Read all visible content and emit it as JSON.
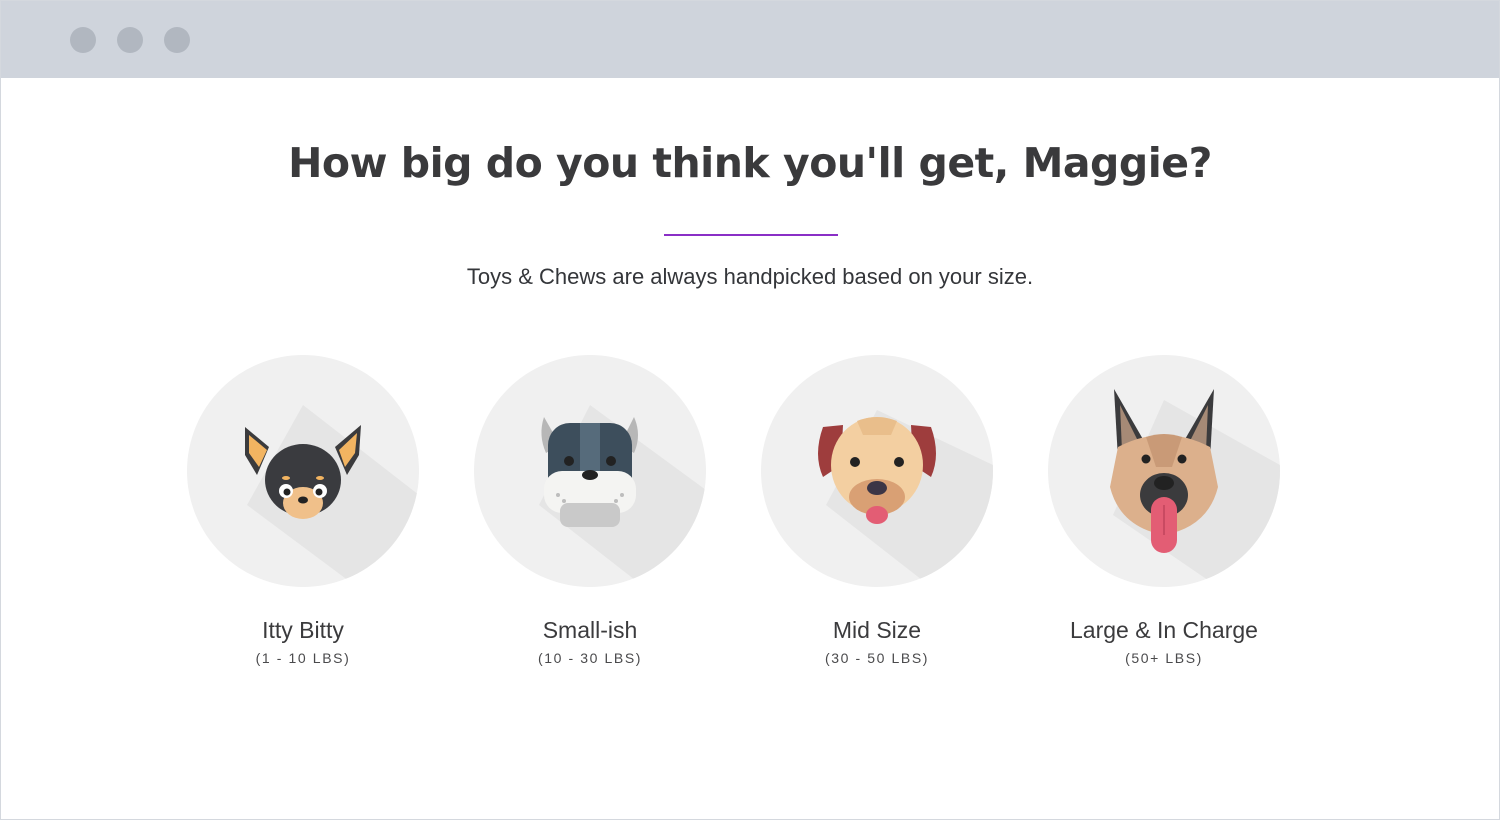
{
  "window": {
    "controls": [
      "window-dot",
      "window-dot",
      "window-dot"
    ]
  },
  "page": {
    "headline": "How big do you think you'll get, Maggie?",
    "subtitle": "Toys & Chews are always handpicked based on your size.",
    "accent_color": "#8a2fc6"
  },
  "size_options": [
    {
      "label": "Itty Bitty",
      "range": "(1 - 10 LBS)",
      "icon": "chihuahua-icon"
    },
    {
      "label": "Small-ish",
      "range": "(10 - 30 LBS)",
      "icon": "bulldog-icon"
    },
    {
      "label": "Mid Size",
      "range": "(30 - 50 LBS)",
      "icon": "retriever-icon"
    },
    {
      "label": "Large & In Charge",
      "range": "(50+ LBS)",
      "icon": "german-shepherd-icon"
    }
  ]
}
